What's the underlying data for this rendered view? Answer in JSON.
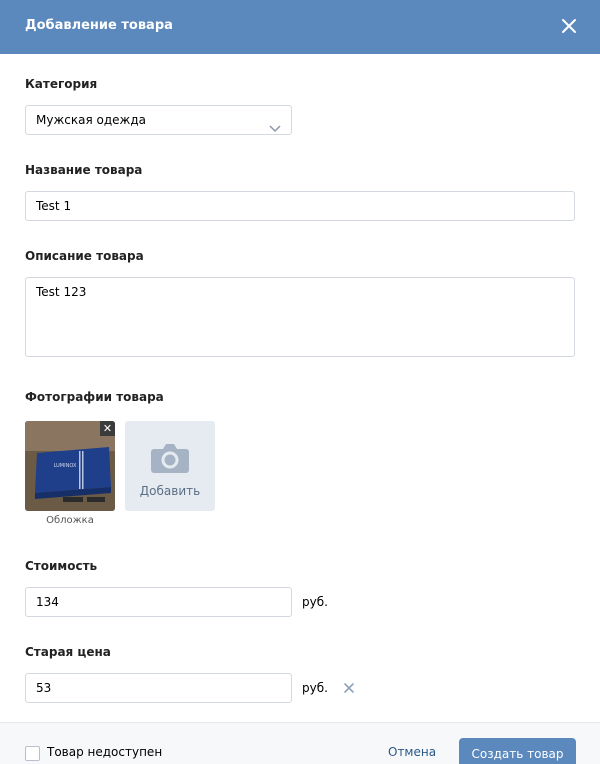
{
  "header": {
    "title": "Добавление товара"
  },
  "category": {
    "label": "Категория",
    "value": "Мужская одежда"
  },
  "name": {
    "label": "Название товара",
    "value": "Test 1"
  },
  "description": {
    "label": "Описание товара",
    "value": "Test 123"
  },
  "photos": {
    "label": "Фотографии товара",
    "cover_caption": "Обложка",
    "add_label": "Добавить",
    "photo_text": "LUMINOX"
  },
  "price": {
    "label": "Стоимость",
    "value": "134",
    "unit": "руб."
  },
  "old_price": {
    "label": "Старая цена",
    "value": "53",
    "unit": "руб."
  },
  "footer": {
    "unavailable_label": "Товар недоступен",
    "cancel_label": "Отмена",
    "create_label": "Создать товар"
  },
  "colors": {
    "accent": "#5b88bd",
    "link": "#2a5885"
  }
}
